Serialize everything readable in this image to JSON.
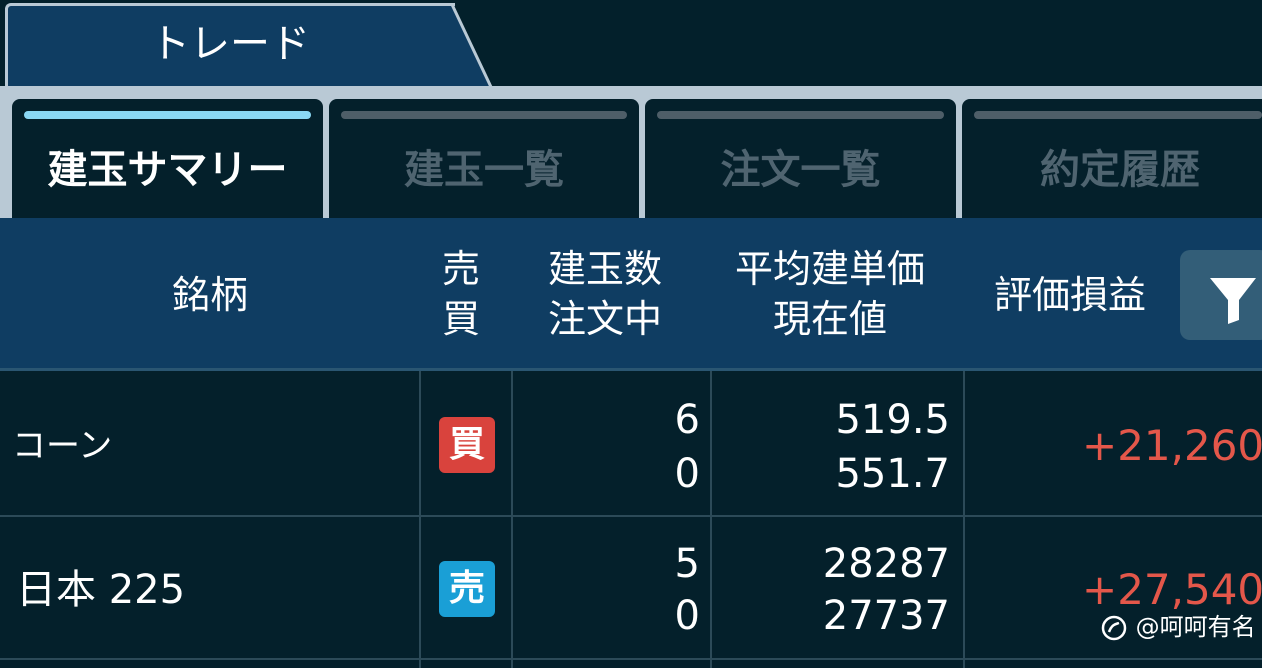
{
  "header_tab": {
    "label": "トレード"
  },
  "subtabs": [
    {
      "label": "建玉サマリー",
      "active": true
    },
    {
      "label": "建玉一覧",
      "active": false
    },
    {
      "label": "注文一覧",
      "active": false
    },
    {
      "label": "約定履歴",
      "active": false
    }
  ],
  "columns": {
    "name": "銘柄",
    "side_line1": "売",
    "side_line2": "買",
    "qty_line1": "建玉数",
    "qty_line2": "注文中",
    "price_line1": "平均建単価",
    "price_line2": "現在値",
    "pnl": "評価損益",
    "filter_icon": "filter-icon"
  },
  "rows": [
    {
      "name": "コーン",
      "side": "買",
      "position_qty": "6",
      "order_qty": "0",
      "avg_price": "519.5",
      "current_price": "551.7",
      "pnl": "+21,260"
    },
    {
      "name": "日本 225",
      "side": "売",
      "position_qty": "5",
      "order_qty": "0",
      "avg_price": "28287",
      "current_price": "27737",
      "pnl": "+27,540"
    }
  ],
  "colors": {
    "buy_badge": "#d9433d",
    "sell_badge": "#1a9fd6",
    "profit": "#e4574a",
    "header_bg": "#0f3d62",
    "body_bg": "#04202b"
  },
  "watermark": {
    "text": "@呵呵有名"
  }
}
